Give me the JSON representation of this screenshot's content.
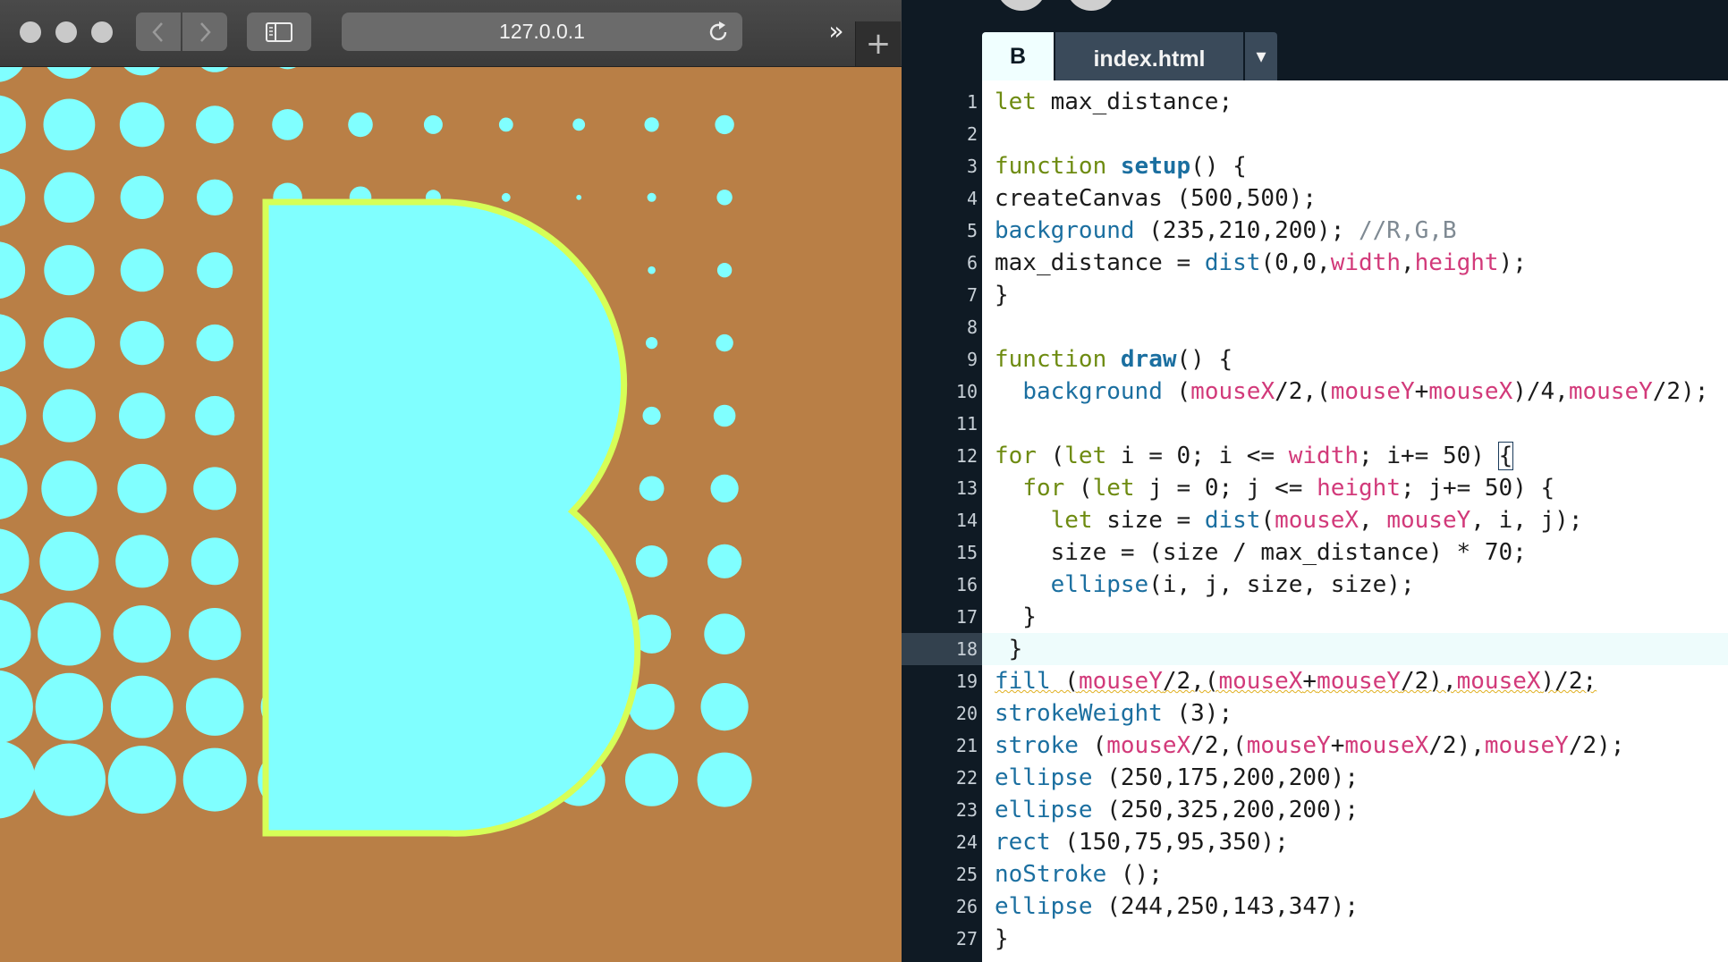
{
  "browser": {
    "url": "127.0.0.1",
    "icons": {
      "back": "chevron-left-icon",
      "forward": "chevron-right-icon",
      "sidebar": "sidebar-icon",
      "reload": "reload-icon",
      "overflow": "double-chevron-right-icon",
      "new_tab": "plus-icon"
    },
    "overflow_label": "»",
    "new_tab_label": "+",
    "canvas": {
      "background_color": "#b97f46",
      "dot_color": "#80ffff",
      "shape_fill": "#80ffff",
      "shape_stroke": "#d6ff57"
    }
  },
  "editor": {
    "tabs": [
      {
        "label": "B",
        "active": true
      },
      {
        "label": "index.html",
        "active": false
      }
    ],
    "dropdown_label": "▾",
    "active_line": 18,
    "lines": [
      {
        "n": "1"
      },
      {
        "n": "2"
      },
      {
        "n": "3"
      },
      {
        "n": "4"
      },
      {
        "n": "5"
      },
      {
        "n": "6"
      },
      {
        "n": "7"
      },
      {
        "n": "8"
      },
      {
        "n": "9"
      },
      {
        "n": "10"
      },
      {
        "n": "11"
      },
      {
        "n": "12"
      },
      {
        "n": "13"
      },
      {
        "n": "14"
      },
      {
        "n": "15"
      },
      {
        "n": "16"
      },
      {
        "n": "17"
      },
      {
        "n": "18"
      },
      {
        "n": "19"
      },
      {
        "n": "20"
      },
      {
        "n": "21"
      },
      {
        "n": "22"
      },
      {
        "n": "23"
      },
      {
        "n": "24"
      },
      {
        "n": "25"
      },
      {
        "n": "26"
      },
      {
        "n": "27"
      }
    ],
    "code": {
      "l1": [
        [
          "let"
        ],
        [
          " max_distance;"
        ]
      ],
      "l3a": "function",
      "l3b": "setup",
      "l3c": "() {",
      "l4": "createCanvas (500,500);",
      "l5a": "background",
      "l5b": " (235,210,200); ",
      "l5c": "//R,G,B",
      "l6a": "max_distance = ",
      "l6b": "dist",
      "l6c": "(0,0,",
      "l6d": "width",
      "l6e": ",",
      "l6f": "height",
      "l6g": ");",
      "l7": "}",
      "l9a": "function",
      "l9b": "draw",
      "l9c": "() {",
      "l10a": "  ",
      "l10b": "background",
      "l10c": " (",
      "l10d": "mouseX",
      "l10e": "/2,(",
      "l10f": "mouseY",
      "l10g": "+",
      "l10h": "mouseX",
      "l10i": ")/4,",
      "l10j": "mouseY",
      "l10k": "/2);",
      "l12a": "for",
      "l12b": " (",
      "l12c": "let",
      "l12d": " i = 0; i <= ",
      "l12e": "width",
      "l12f": "; i+= 50) ",
      "l12g": "{",
      "l13a": "  ",
      "l13b": "for",
      "l13c": " (",
      "l13d": "let",
      "l13e": " j = 0; j <= ",
      "l13f": "height",
      "l13g": "; j+= 50) {",
      "l14a": "    ",
      "l14b": "let",
      "l14c": " size = ",
      "l14d": "dist",
      "l14e": "(",
      "l14f": "mouseX",
      "l14g": ", ",
      "l14h": "mouseY",
      "l14i": ", i, j);",
      "l15": "    size = (size / max_distance) * 70;",
      "l16a": "    ",
      "l16b": "ellipse",
      "l16c": "(i, j, size, size);",
      "l17": "  }",
      "l18": " }",
      "l19a": "fill",
      "l19b": " (",
      "l19c": "mouseY",
      "l19d": "/2,(",
      "l19e": "mouseX",
      "l19f": "+",
      "l19g": "mouseY",
      "l19h": "/2),",
      "l19i": "mouseX",
      "l19j": ")/2;",
      "l20a": "strokeWeight",
      "l20b": " (3);",
      "l21a": "stroke",
      "l21b": " (",
      "l21c": "mouseX",
      "l21d": "/2,(",
      "l21e": "mouseY",
      "l21f": "+",
      "l21g": "mouseX",
      "l21h": "/2),",
      "l21i": "mouseY",
      "l21j": "/2);",
      "l22a": "ellipse",
      "l22b": " (250,175,200,200);",
      "l23a": "ellipse",
      "l23b": " (250,325,200,200);",
      "l24a": "rect",
      "l24b": " (150,75,95,350);",
      "l25a": "noStroke",
      "l25b": " ();",
      "l26a": "ellipse",
      "l26b": " (244,250,143,347);",
      "l27": "}"
    }
  }
}
